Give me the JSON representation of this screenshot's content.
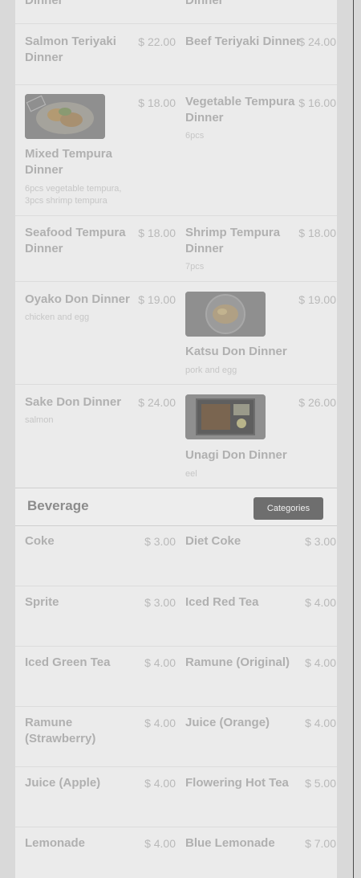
{
  "rows": [
    {
      "left": {
        "name_l1": "Dinner"
      },
      "right": {
        "name_l1": "Dinner"
      }
    },
    {
      "left": {
        "name_l1": "Salmon Teriyaki",
        "name_l2": "Dinner",
        "price": "$ 22.00"
      },
      "right": {
        "name_l1": "Beef Teriyaki Dinner",
        "price": "$ 24.00"
      }
    },
    {
      "left": {
        "name_l1": "Mixed Tempura",
        "name_l2": "Dinner",
        "price": "$ 18.00",
        "desc_l1": "6pcs vegetable tempura,",
        "desc_l2": "3pcs shrimp tempura"
      },
      "right": {
        "name_l1": "Vegetable Tempura",
        "name_l2": "Dinner",
        "price": "$ 16.00",
        "desc_l1": "6pcs"
      }
    },
    {
      "left": {
        "name_l1": "Seafood Tempura",
        "name_l2": "Dinner",
        "price": "$ 18.00"
      },
      "right": {
        "name_l1": "Shrimp Tempura",
        "name_l2": "Dinner",
        "price": "$ 18.00",
        "desc_l1": "7pcs"
      }
    },
    {
      "left": {
        "name_l1": "Oyako Don Dinner",
        "price": "$ 19.00",
        "desc_l1": "chicken and egg"
      },
      "right": {
        "name_l1": "Katsu Don Dinner",
        "price": "$ 19.00",
        "desc_l1": "pork and egg"
      }
    },
    {
      "left": {
        "name_l1": "Sake Don Dinner",
        "price": "$ 24.00",
        "desc_l1": "salmon"
      },
      "right": {
        "name_l1": "Unagi Don Dinner",
        "price": "$ 26.00",
        "desc_l1": "eel"
      }
    }
  ],
  "section": {
    "title": "Beverage",
    "categories_label": "Categories"
  },
  "beverages": [
    {
      "left": {
        "name_l1": "Coke",
        "price": "$ 3.00"
      },
      "right": {
        "name_l1": "Diet Coke",
        "price": "$ 3.00"
      }
    },
    {
      "left": {
        "name_l1": "Sprite",
        "price": "$ 3.00"
      },
      "right": {
        "name_l1": "Iced Red Tea",
        "price": "$ 4.00"
      }
    },
    {
      "left": {
        "name_l1": "Iced Green Tea",
        "price": "$ 4.00"
      },
      "right": {
        "name_l1": "Ramune (Original)",
        "price": "$ 4.00"
      }
    },
    {
      "left": {
        "name_l1": "Ramune",
        "name_l2": "(Strawberry)",
        "price": "$ 4.00"
      },
      "right": {
        "name_l1": "Juice (Orange)",
        "price": "$ 4.00"
      }
    },
    {
      "left": {
        "name_l1": "Juice (Apple)",
        "price": "$ 4.00"
      },
      "right": {
        "name_l1": "Flowering Hot Tea",
        "price": "$ 5.00"
      }
    },
    {
      "left": {
        "name_l1": "Lemonade",
        "price": "$ 4.00"
      },
      "right": {
        "name_l1": "Blue Lemonade",
        "price": "$ 7.00"
      }
    }
  ]
}
